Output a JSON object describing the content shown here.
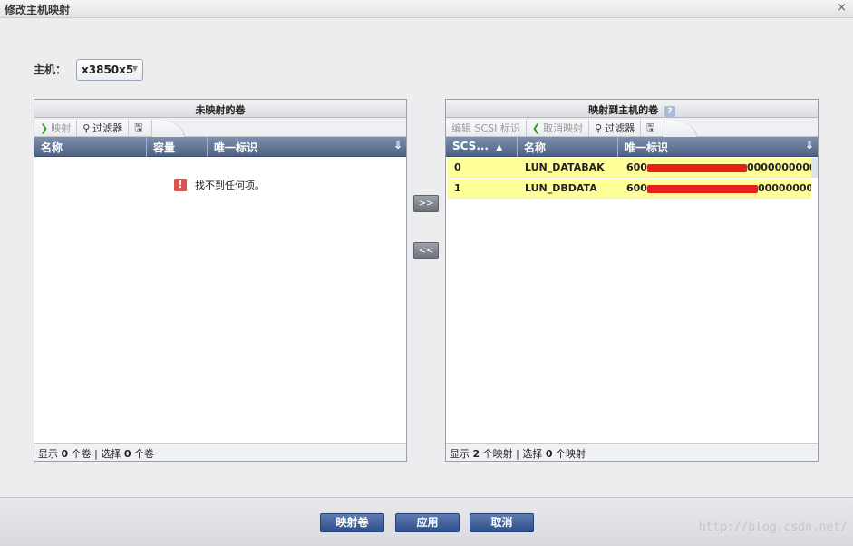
{
  "window": {
    "title": "修改主机映射",
    "close_glyph": "×"
  },
  "host": {
    "label": "主机：",
    "selected": "x3850x5"
  },
  "left_panel": {
    "title": "未映射的卷",
    "toolbar": {
      "map_label": "映射",
      "filter_label": "过滤器"
    },
    "columns": [
      "名称",
      "容量",
      "唯一标识"
    ],
    "empty_message": "找不到任何项。",
    "status": {
      "prefix": "显示",
      "shown": "0",
      "mid": "个卷 | 选择",
      "selected": "0",
      "suffix": "个卷"
    }
  },
  "right_panel": {
    "title": "映射到主机的卷",
    "toolbar": {
      "edit_scsi_label": "编辑 SCSI 标识",
      "unmap_label": "取消映射",
      "filter_label": "过滤器"
    },
    "columns": [
      "SCS...",
      "名称",
      "唯一标识"
    ],
    "rows": [
      {
        "scsi": "0",
        "name": "LUN_DATABAK",
        "uid_prefix": "600",
        "uid_suffix": "0000000000..."
      },
      {
        "scsi": "1",
        "name": "LUN_DBDATA",
        "uid_prefix": "600",
        "uid_suffix": "0000000000..."
      }
    ],
    "status": {
      "prefix": "显示",
      "shown": "2",
      "mid": "个映射 | 选择",
      "selected": "0",
      "suffix": "个映射"
    }
  },
  "move_buttons": {
    "add": ">>",
    "remove": "<<"
  },
  "footer": {
    "map_volume": "映射卷",
    "apply": "应用",
    "cancel": "取消"
  },
  "watermark": "http://blog.csdn.net/"
}
